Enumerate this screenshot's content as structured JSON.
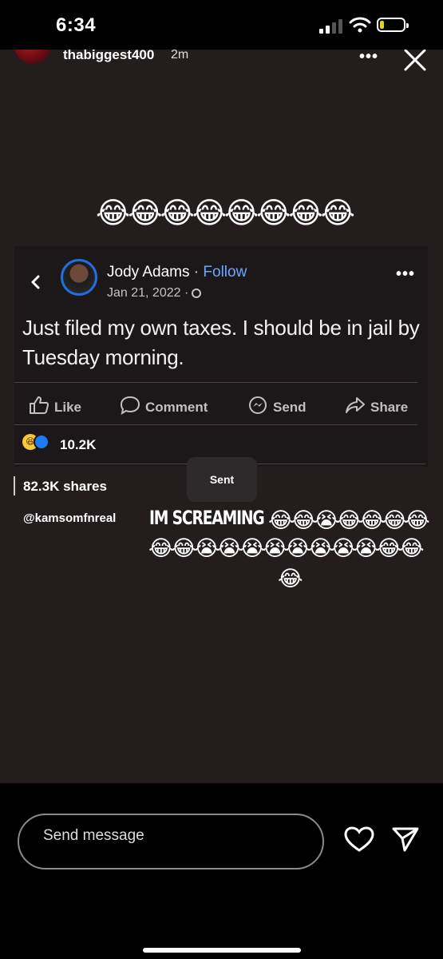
{
  "status_bar": {
    "time": "6:34"
  },
  "story": {
    "username": "thabiggest400",
    "posted_ago": "2m",
    "emoji_row": "😂😂😂😂😂😂😂😂"
  },
  "post": {
    "author": "Jody Adams",
    "separator": " · ",
    "follow_label": "Follow",
    "date": "Jan 21, 2022 ·",
    "text": "Just filed my own taxes. I should be in jail by Tuesday morning.",
    "actions": {
      "like": "Like",
      "comment": "Comment",
      "send": "Send",
      "share": "Share"
    },
    "reaction_count": "10.2K",
    "shares": "82.3K shares"
  },
  "overlay": {
    "sent_label": "Sent",
    "handle": "@kamsomfnreal",
    "caption_text": "IM SCREAMING",
    "caption_emoji_1": "😂😂😭😂😂😂😂",
    "caption_emoji_2": "😂😂😭😭😭😭😭😭😭😭😂😂",
    "caption_emoji_3": "😂"
  },
  "composer": {
    "placeholder": "Send message"
  },
  "colors": {
    "follow": "#6aa6ff",
    "avatar_ring": "#1f6fe0",
    "background": "#231d1e"
  }
}
